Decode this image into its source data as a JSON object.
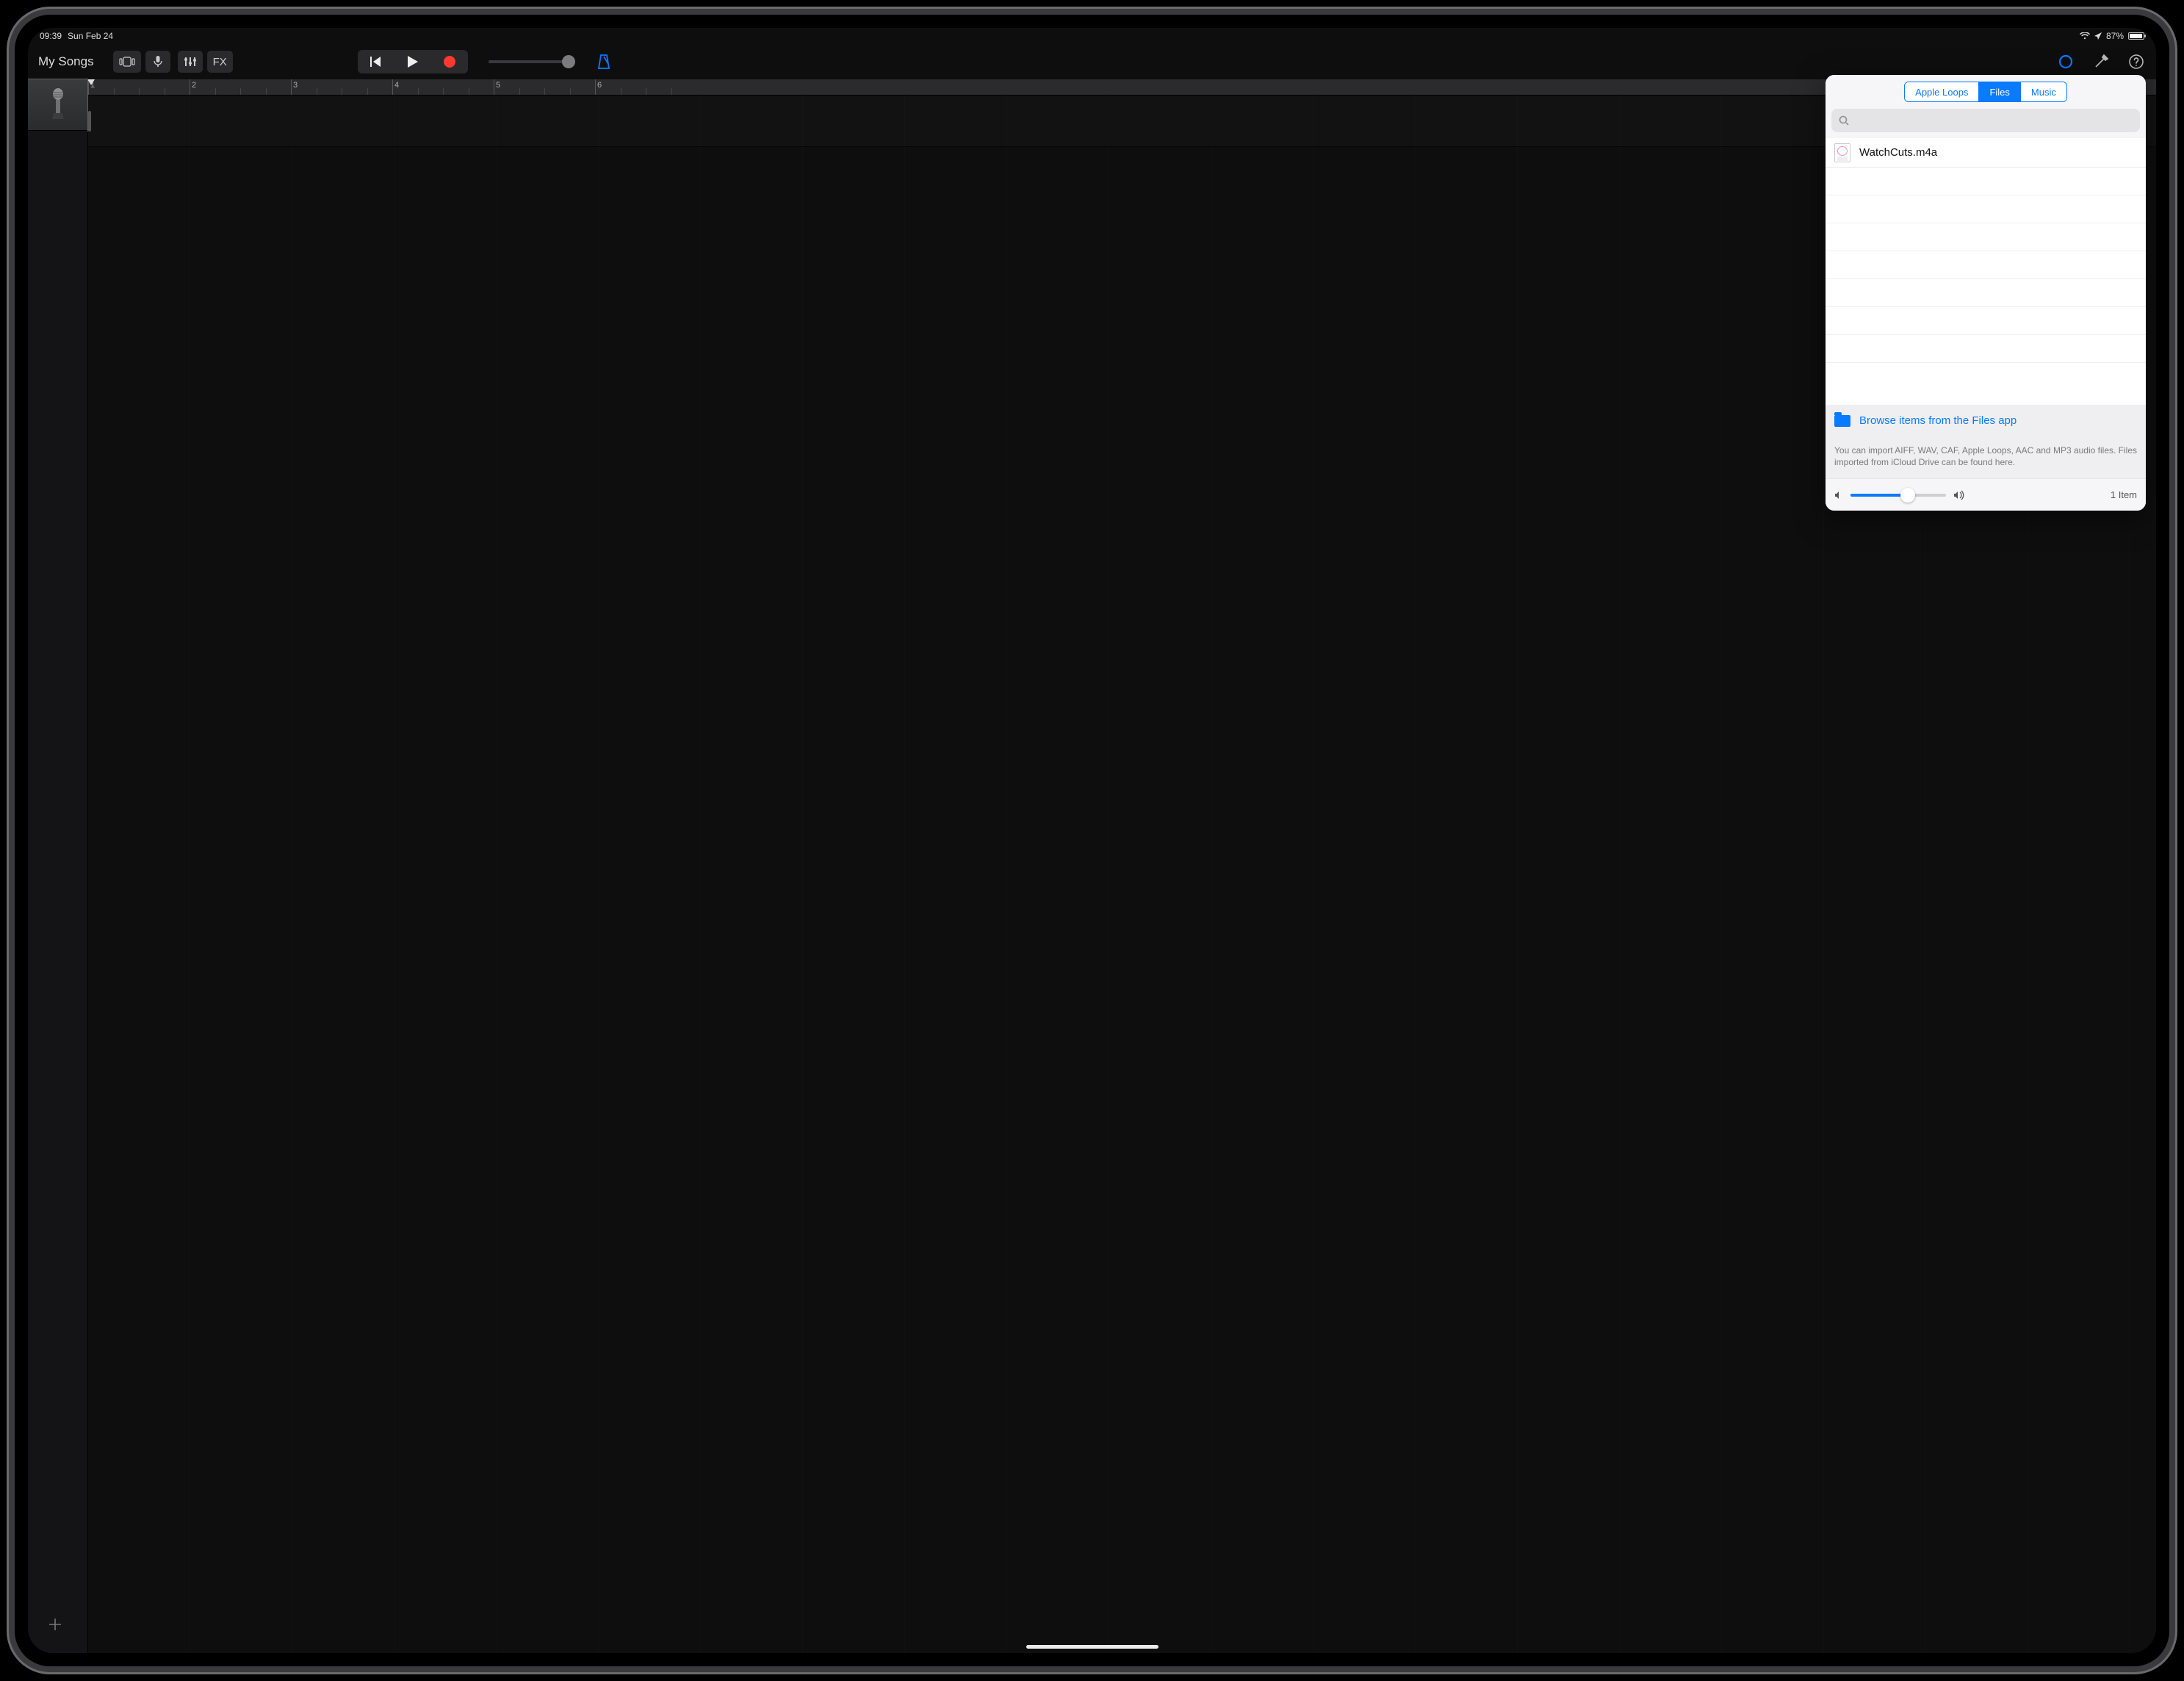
{
  "status": {
    "time": "09:39",
    "date": "Sun Feb 24",
    "battery_pct": "87%"
  },
  "toolbar": {
    "my_songs": "My Songs",
    "fx_label": "FX"
  },
  "ruler": {
    "markers": [
      "1",
      "2",
      "3",
      "4",
      "5",
      "6"
    ]
  },
  "popover": {
    "segments": {
      "loops": "Apple Loops",
      "files": "Files",
      "music": "Music",
      "active": "files"
    },
    "search_placeholder": "",
    "files": [
      {
        "name": "WatchCuts.m4a"
      }
    ],
    "browse_label": "Browse items from the Files app",
    "help_text": "You can import AIFF, WAV, CAF, Apple Loops, AAC and MP3 audio files. Files imported from iCloud Drive can be found here.",
    "preview_volume_pct": 60,
    "item_count_label": "1 Item"
  },
  "colors": {
    "accent": "#0a7aff",
    "record": "#ff3a2f"
  }
}
